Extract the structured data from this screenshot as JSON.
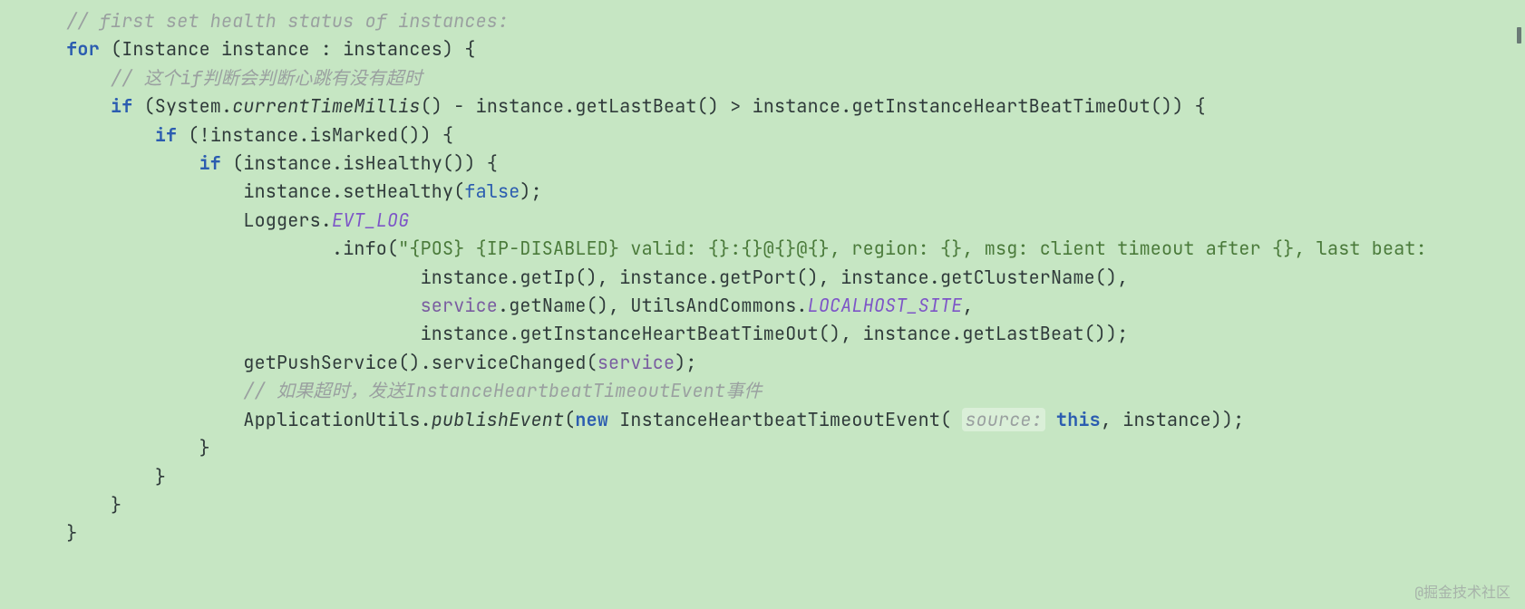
{
  "watermark": "@掘金技术社区",
  "code": {
    "c1": "// first set health status of instances:",
    "for": "for",
    "l2rest": " (Instance instance : instances) {",
    "c2": "// 这个if判断会判断心跳有没有超时",
    "if": "if",
    "l4a": " (System.",
    "ctm": "currentTimeMillis",
    "l4b": "() - instance.getLastBeat() > instance.getInstanceHeartBeatTimeOut()) {",
    "l5": " (!instance.isMarked()) {",
    "l6": " (instance.isHealthy()) {",
    "l7a": "instance.setHealthy(",
    "false": "false",
    "l7b": ");",
    "l8a": "Loggers.",
    "evt": "EVT_LOG",
    "l9a": ".info(",
    "str1": "\"{POS} {IP-DISABLED} valid: {}:{}@{}@{}, region: {}, msg: client timeout after {}, last beat:",
    "l10": "instance.getIp(), instance.getPort(), instance.getClusterName(),",
    "l11a_par": "service",
    "l11a": ".getName(), UtilsAndCommons.",
    "localhost": "LOCALHOST_SITE",
    "l11b": ",",
    "l12": "instance.getInstanceHeartBeatTimeOut(), instance.getLastBeat());",
    "l13a": "getPushService().serviceChanged(",
    "service": "service",
    "l13b": ");",
    "c3": "// 如果超时，发送InstanceHeartbeatTimeoutEvent事件",
    "l15a": "ApplicationUtils.",
    "publish": "publishEvent",
    "l15b": "(",
    "new": "new",
    "l15c": " InstanceHeartbeatTimeoutEvent( ",
    "hint": "source:",
    "sp": " ",
    "this": "this",
    "l15d": ", instance));",
    "rb": "}"
  }
}
